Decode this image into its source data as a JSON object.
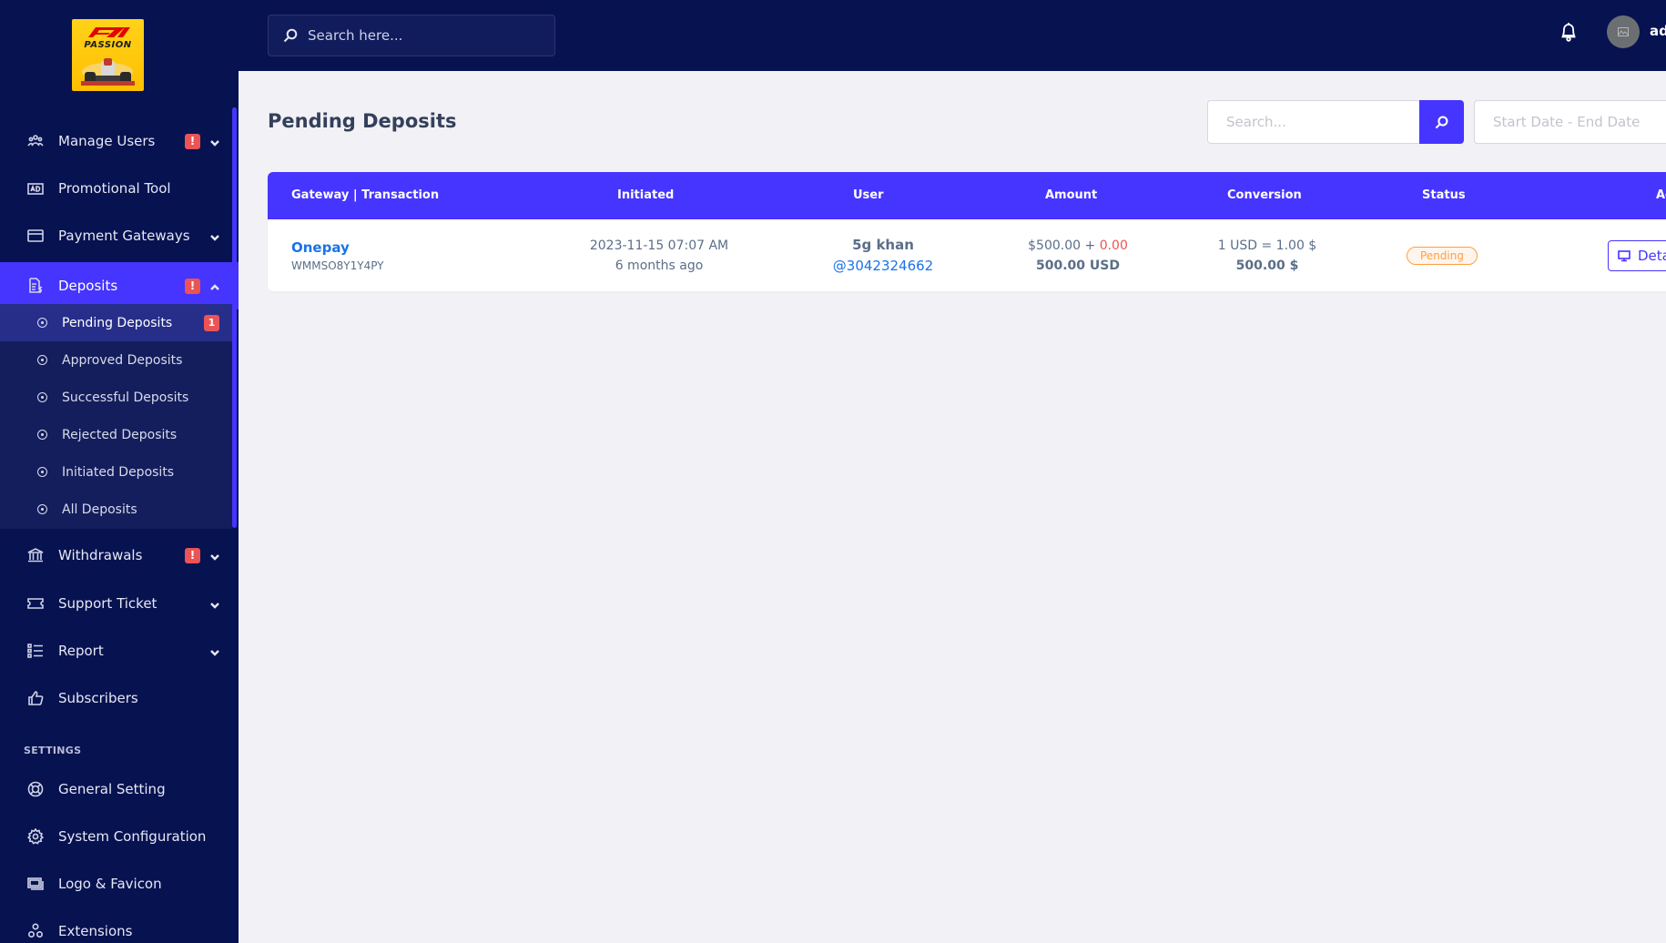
{
  "sidebar": {
    "logo_text": "PASSION",
    "items": [
      {
        "label": "Manage Users",
        "icon": "users-icon",
        "alert": "!",
        "chevron": "down"
      },
      {
        "label": "Promotional Tool",
        "icon": "ad-icon"
      },
      {
        "label": "Payment Gateways",
        "icon": "credit-card-icon",
        "chevron": "down"
      },
      {
        "label": "Deposits",
        "icon": "invoice-dollar-icon",
        "alert": "!",
        "chevron": "up",
        "active": true
      },
      {
        "label": "Withdrawals",
        "icon": "bank-icon",
        "alert": "!",
        "chevron": "down"
      },
      {
        "label": "Support Ticket",
        "icon": "ticket-icon",
        "chevron": "down"
      },
      {
        "label": "Report",
        "icon": "list-icon",
        "chevron": "down"
      },
      {
        "label": "Subscribers",
        "icon": "thumbs-up-icon"
      }
    ],
    "deposits_submenu": [
      {
        "label": "Pending Deposits",
        "count": "1",
        "active": true
      },
      {
        "label": "Approved Deposits"
      },
      {
        "label": "Successful Deposits"
      },
      {
        "label": "Rejected Deposits"
      },
      {
        "label": "Initiated Deposits"
      },
      {
        "label": "All Deposits"
      }
    ],
    "settings_title": "SETTINGS",
    "settings_items": [
      {
        "label": "General Setting",
        "icon": "lifebuoy-icon"
      },
      {
        "label": "System Configuration",
        "icon": "gear-icon"
      },
      {
        "label": "Logo & Favicon",
        "icon": "images-icon"
      },
      {
        "label": "Extensions",
        "icon": "cubes-icon"
      }
    ]
  },
  "topbar": {
    "search_placeholder": "Search here...",
    "username": "admin"
  },
  "main": {
    "title": "Pending Deposits",
    "search_placeholder": "Search...",
    "date_placeholder": "Start Date - End Date",
    "table": {
      "columns": [
        "Gateway | Transaction",
        "Initiated",
        "User",
        "Amount",
        "Conversion",
        "Status",
        "Action"
      ],
      "rows": [
        {
          "gateway": "Onepay",
          "trx": "WMMSO8Y1Y4PY",
          "initiated_date": "2023-11-15 07:07 AM",
          "initiated_ago": "6 months ago",
          "user_name": "5g khan",
          "user_handle": "@3042324662",
          "amount": "$500.00",
          "amount_plus": " + ",
          "charge": "0.00",
          "amount_total": "500.00 USD",
          "conversion_rate": "1 USD = 1.00 $",
          "conversion_total": "500.00 $",
          "status": "Pending",
          "action": "Details"
        }
      ]
    }
  },
  "colors": {
    "sidebar_bg": "#071251",
    "accent": "#4634ff",
    "danger": "#ea5455",
    "warning": "#ff9f43",
    "link": "#1a73e8"
  }
}
